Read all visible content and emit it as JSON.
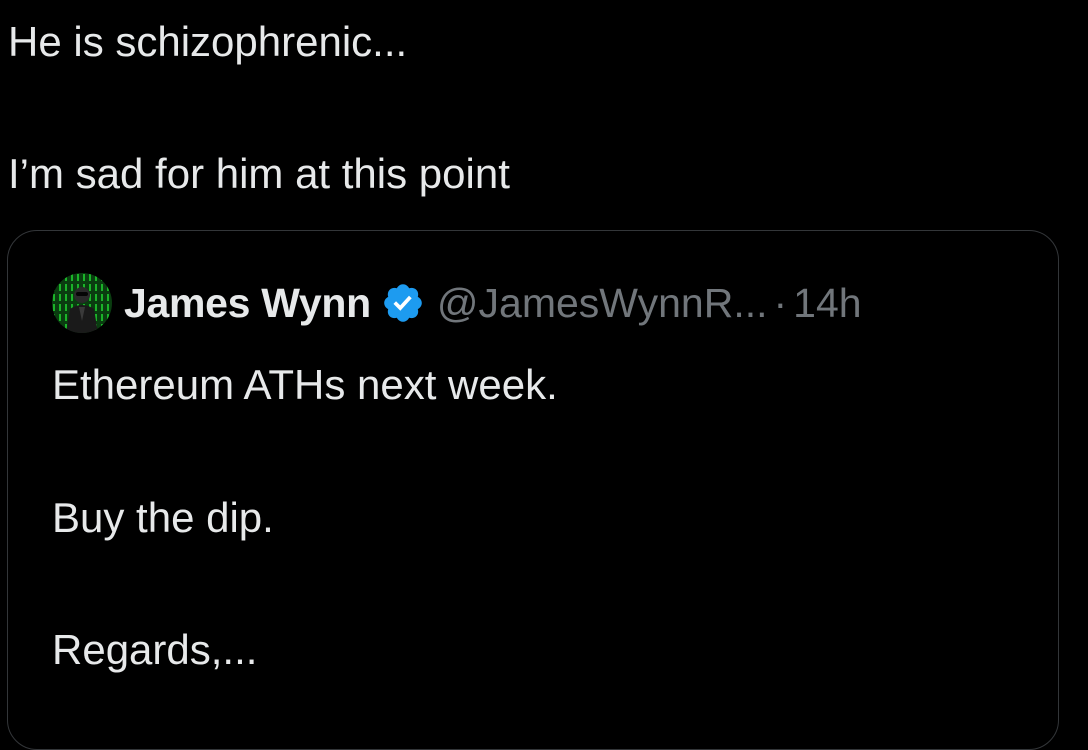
{
  "tweet": {
    "lines": [
      "He is schizophrenic...",
      "I’m sad for him at this point"
    ]
  },
  "quoted_tweet": {
    "author_name": "James Wynn",
    "handle": "@JamesWynnR...",
    "separator": "·",
    "timestamp": "14h",
    "verified": true,
    "lines": [
      "Ethereum ATHs next week.",
      "Buy the dip.",
      "Regards,..."
    ]
  },
  "colors": {
    "background": "#000000",
    "text_primary": "#e7e9ea",
    "text_secondary": "#71767b",
    "border": "#333639",
    "verified_badge": "#1d9bf0"
  },
  "icons": {
    "verified": "verified-badge-icon",
    "avatar": "avatar-image"
  }
}
